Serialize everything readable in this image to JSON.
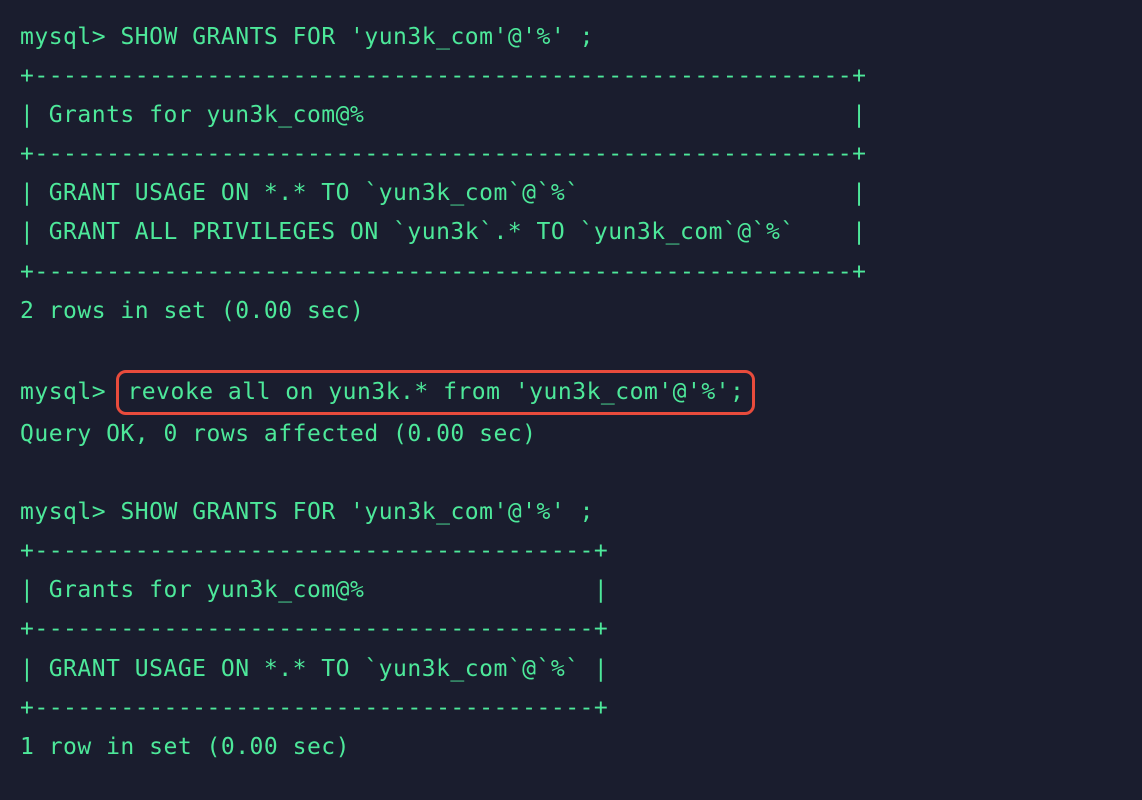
{
  "colors": {
    "background": "#1a1d2e",
    "text": "#4de89a",
    "highlight_border": "#e84b3c"
  },
  "terminal": {
    "prompt": "mysql>",
    "session1": {
      "command": "SHOW GRANTS FOR 'yun3k_com'@'%' ;",
      "divider_long": "+---------------------------------------------------------+",
      "header": "| Grants for yun3k_com@%                                  |",
      "row1": "| GRANT USAGE ON *.* TO `yun3k_com`@`%`                   |",
      "row2": "| GRANT ALL PRIVILEGES ON `yun3k`.* TO `yun3k_com`@`%`    |",
      "result": "2 rows in set (0.00 sec)"
    },
    "session2": {
      "command_highlighted": "revoke all on yun3k.* from 'yun3k_com'@'%';",
      "result": "Query OK, 0 rows affected (0.00 sec)"
    },
    "session3": {
      "command": "SHOW GRANTS FOR 'yun3k_com'@'%' ;",
      "divider_short": "+---------------------------------------+",
      "header": "| Grants for yun3k_com@%                |",
      "row1": "| GRANT USAGE ON *.* TO `yun3k_com`@`%` |",
      "result": "1 row in set (0.00 sec)"
    }
  }
}
